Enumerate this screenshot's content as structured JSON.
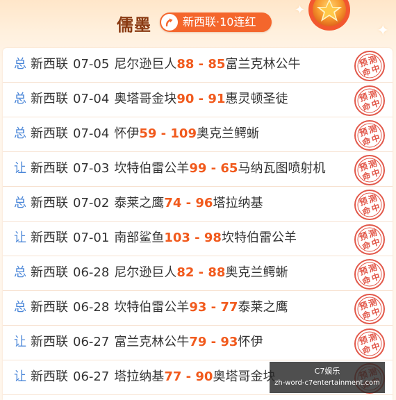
{
  "header": {
    "author": "儒墨",
    "streak_badge": "新西联·10连红",
    "badge_icon": "up-arrow-icon",
    "medal_icon": "star-medal-icon"
  },
  "colors": {
    "accent": "#f4662c",
    "score": "#f15a1d",
    "tag": "#4a86d8",
    "stamp": "#e2584a"
  },
  "stamp_label": [
    "预",
    "测",
    "命",
    "中"
  ],
  "predictions": [
    {
      "tag": "总",
      "league": "新西联",
      "date": "07-05",
      "home": "尼尔逊巨人",
      "home_score": "88",
      "sep": " - ",
      "away_score": "85",
      "away": "富兰克林公牛"
    },
    {
      "tag": "总",
      "league": "新西联",
      "date": "07-04",
      "home": "奥塔哥金块",
      "home_score": "90",
      "sep": " - ",
      "away_score": "91",
      "away": "惠灵顿圣徒"
    },
    {
      "tag": "总",
      "league": "新西联",
      "date": "07-04",
      "home": "怀伊",
      "home_score": "59",
      "sep": " - ",
      "away_score": "109",
      "away": "奥克兰鳄蜥"
    },
    {
      "tag": "让",
      "league": "新西联",
      "date": "07-03",
      "home": "坎特伯雷公羊",
      "home_score": "99",
      "sep": " - ",
      "away_score": "65",
      "away": "马纳瓦图喷射机"
    },
    {
      "tag": "总",
      "league": "新西联",
      "date": "07-02",
      "home": "泰莱之鹰",
      "home_score": "74",
      "sep": " - ",
      "away_score": "96",
      "away": "塔拉纳基"
    },
    {
      "tag": "让",
      "league": "新西联",
      "date": "07-01",
      "home": "南部鲨鱼",
      "home_score": "103",
      "sep": " - ",
      "away_score": "98",
      "away": "坎特伯雷公羊"
    },
    {
      "tag": "总",
      "league": "新西联",
      "date": "06-28",
      "home": "尼尔逊巨人",
      "home_score": "82",
      "sep": " - ",
      "away_score": "88",
      "away": "奥克兰鳄蜥"
    },
    {
      "tag": "总",
      "league": "新西联",
      "date": "06-28",
      "home": "坎特伯雷公羊",
      "home_score": "93",
      "sep": " - ",
      "away_score": "77",
      "away": "泰莱之鹰"
    },
    {
      "tag": "让",
      "league": "新西联",
      "date": "06-27",
      "home": "富兰克林公牛",
      "home_score": "79",
      "sep": " - ",
      "away_score": "93",
      "away": "怀伊"
    },
    {
      "tag": "让",
      "league": "新西联",
      "date": "06-27",
      "home": "塔拉纳基",
      "home_score": "77",
      "sep": " - ",
      "away_score": "90",
      "away": "奥塔哥金块"
    }
  ],
  "watermark": {
    "line1": "C7娱乐",
    "line2": "zh-word-c7entertainment.com"
  }
}
